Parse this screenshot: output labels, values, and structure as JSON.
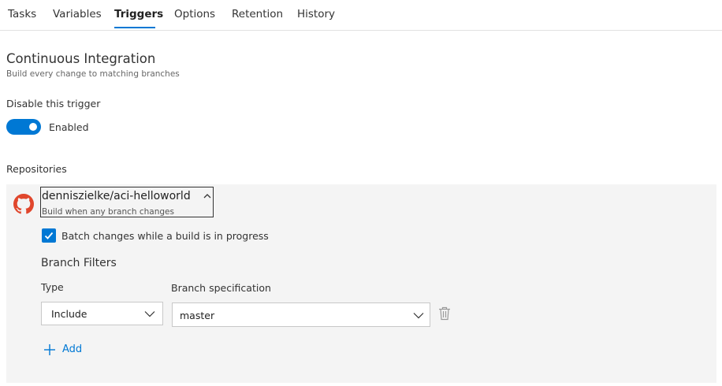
{
  "tabs": [
    {
      "label": "Tasks"
    },
    {
      "label": "Variables"
    },
    {
      "label": "Triggers",
      "active": true
    },
    {
      "label": "Options"
    },
    {
      "label": "Retention"
    },
    {
      "label": "History"
    }
  ],
  "ci": {
    "title": "Continuous Integration",
    "subtitle": "Build every change to matching branches",
    "disable_label": "Disable this trigger",
    "toggle_state": "Enabled",
    "toggle_on": true
  },
  "repositories": {
    "label": "Repositories",
    "repo": {
      "icon": "github-icon",
      "name": "denniszielke/aci-helloworld",
      "description": "Build when any branch changes",
      "expanded": true,
      "batch_label": "Batch changes while a build is in progress",
      "batch_checked": true,
      "branch_filters": {
        "title": "Branch Filters",
        "type_label": "Type",
        "branch_spec_label": "Branch specification",
        "type_value": "Include",
        "branch_value": "master",
        "add_label": "Add"
      }
    }
  },
  "colors": {
    "accent": "#0078d4",
    "github": "#e0462c",
    "panel_bg": "#f4f4f4"
  }
}
